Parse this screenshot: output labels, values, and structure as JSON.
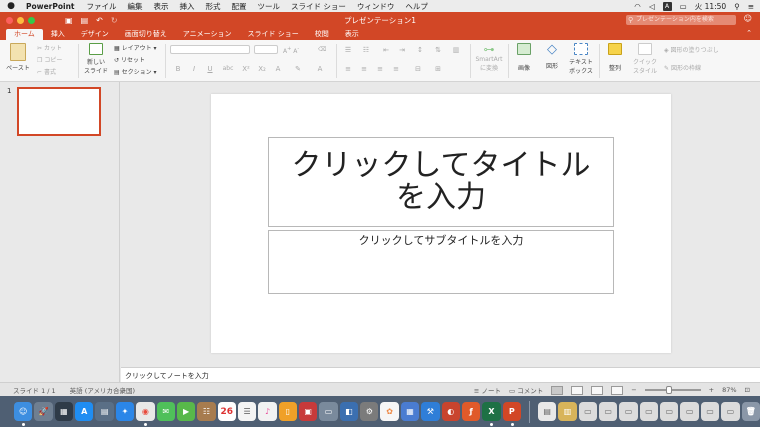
{
  "menubar": {
    "app_name": "PowerPoint",
    "items": [
      "ファイル",
      "編集",
      "表示",
      "挿入",
      "形式",
      "配置",
      "ツール",
      "スライド ショー",
      "ウィンドウ",
      "ヘルプ"
    ],
    "input_badge": "A",
    "clock": "火 11:50"
  },
  "titlebar": {
    "title": "プレゼンテーション1",
    "search_placeholder": "プレゼンテーション内を検索"
  },
  "tabs": [
    "ホーム",
    "挿入",
    "デザイン",
    "画面切り替え",
    "アニメーション",
    "スライド ショー",
    "校閲",
    "表示"
  ],
  "ribbon": {
    "paste": "ペースト",
    "cut": "カット",
    "copy": "コピー",
    "format": "書式",
    "new_slide_1": "新しい",
    "new_slide_2": "スライド",
    "layout": "レイアウト",
    "reset": "リセット",
    "section": "セクション",
    "smartart_1": "SmartArt",
    "smartart_2": "に変換",
    "picture": "画像",
    "shapes": "図形",
    "textbox_1": "テキスト",
    "textbox_2": "ボックス",
    "arrange": "整列",
    "quick_styles_1": "クイック",
    "quick_styles_2": "スタイル",
    "shape_fill": "図形の塗りつぶし",
    "shape_outline": "図形の枠線"
  },
  "thumbnail": {
    "number": "1"
  },
  "slide": {
    "title_placeholder": "クリックしてタイトルを入力",
    "subtitle_placeholder": "クリックしてサブタイトルを入力"
  },
  "notes": {
    "placeholder": "クリックしてノートを入力"
  },
  "status": {
    "slide_counter": "スライド 1 / 1",
    "language": "英語 (アメリカ合衆国)",
    "notes_btn": "ノート",
    "comments_btn": "コメント",
    "zoom": "87%",
    "zoom_fraction": 0.87
  },
  "dock": {
    "calendar_day": "26"
  },
  "colors": {
    "accent": "#d24726",
    "ribbon_bg": "#f7f7f7",
    "dock_bg": "#4f5f73"
  }
}
